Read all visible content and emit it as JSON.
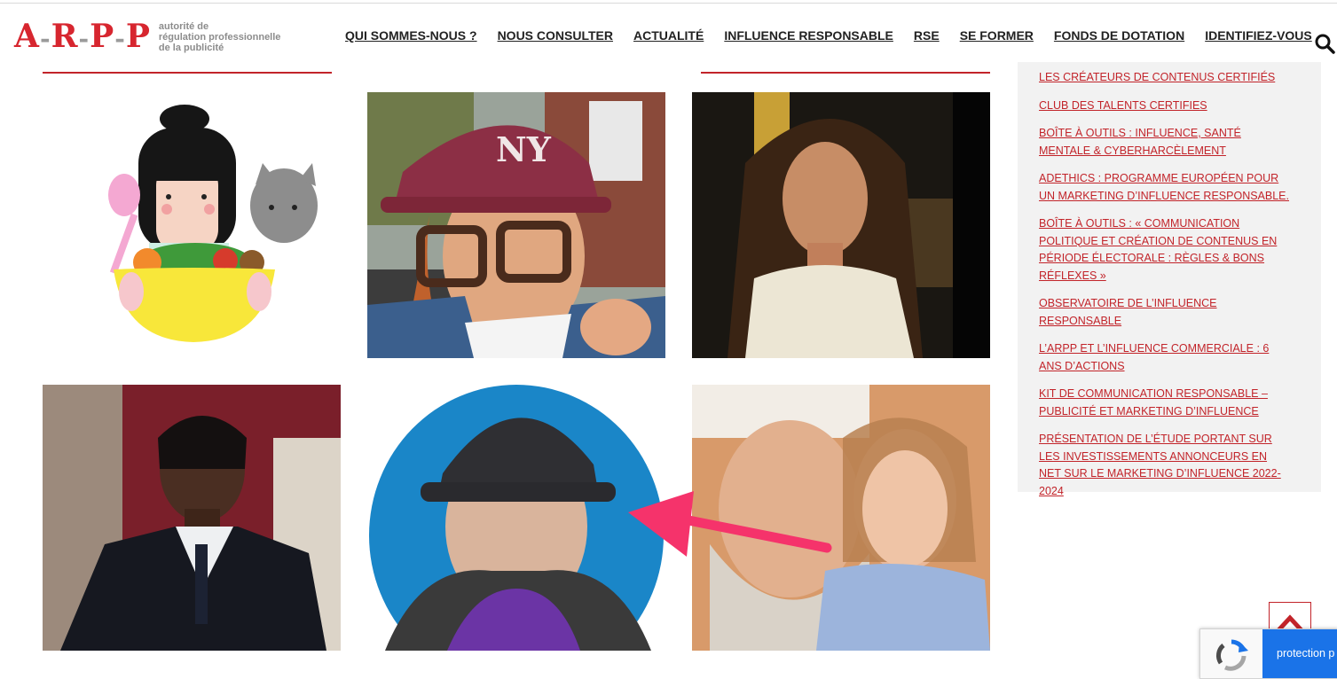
{
  "header": {
    "logo_letters": [
      "A",
      "R",
      "P",
      "P"
    ],
    "logo_tagline": [
      "autorité de",
      "régulation professionnelle",
      "de la publicité"
    ]
  },
  "nav": [
    {
      "label": "QUI SOMMES-NOUS ?"
    },
    {
      "label": "NOUS CONSULTER"
    },
    {
      "label": "ACTUALITÉ"
    },
    {
      "label": "INFLUENCE RESPONSABLE"
    },
    {
      "label": "RSE"
    },
    {
      "label": "SE FORMER"
    },
    {
      "label": "FONDS DE DOTATION"
    },
    {
      "label": "IDENTIFIEZ-VOUS"
    }
  ],
  "icons": {
    "search": "search-icon",
    "back_to_top": "chevron-up-icon",
    "recaptcha": "recaptcha-icon",
    "annotation": "arrow-annotation"
  },
  "colors": {
    "brand_red": "#c2242a",
    "logo_red": "#d7262f",
    "annotation_pink": "#f5336b",
    "recaptcha_blue": "#1a73e8"
  },
  "sidebar": {
    "links": [
      {
        "label": "LES CRÉATEURS DE CONTENUS CERTIFIÉS"
      },
      {
        "label": "CLUB DES TALENTS CERTIFIES"
      },
      {
        "label": "BOÎTE À OUTILS : INFLUENCE, SANTÉ MENTALE & CYBERHARCÈLEMENT"
      },
      {
        "label": "ADETHICS : PROGRAMME EUROPÉEN POUR UN MARKETING D’INFLUENCE RESPONSABLE."
      },
      {
        "label": "BOÎTE À OUTILS : « COMMUNICATION POLITIQUE ET CRÉATION DE CONTENUS EN PÉRIODE ÉLECTORALE : RÈGLES & BONS RÉFLEXES »"
      },
      {
        "label": "OBSERVATOIRE DE L’INFLUENCE RESPONSABLE"
      },
      {
        "label": "L’ARPP ET L’INFLUENCE COMMERCIALE : 6 ANS D’ACTIONS"
      },
      {
        "label": "KIT DE COMMUNICATION RESPONSABLE – PUBLICITÉ ET MARKETING D’INFLUENCE"
      },
      {
        "label": "PRÉSENTATION DE L’ÉTUDE PORTANT SUR LES INVESTISSEMENTS ANNONCEURS EN NET SUR LE MARKETING D’INFLUENCE 2022- 2024"
      }
    ]
  },
  "recaptcha": {
    "label": "protection p"
  }
}
